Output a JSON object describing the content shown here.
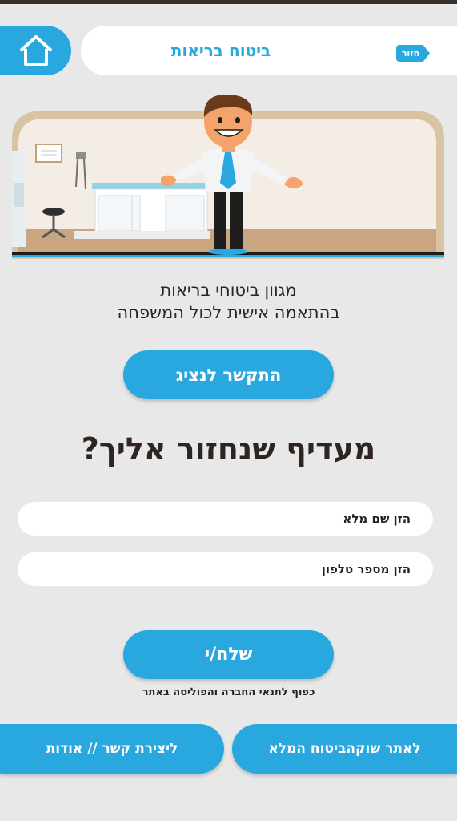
{
  "header": {
    "title": "ביטוח בריאות",
    "back_label": "חזור",
    "home_icon": "home-icon"
  },
  "hero": {
    "icon": "doctor-clinic-illustration"
  },
  "tagline": {
    "line1": "מגוון ביטוחי בריאות",
    "line2": "בהתאמה אישית לכול המשפחה"
  },
  "contact_rep_label": "התקשר לנציג",
  "callback_heading": "מעדיף שנחזור אליך?",
  "form": {
    "name_placeholder": "הזן שם מלא",
    "phone_placeholder": "הזן מספר טלפון",
    "send_label": "שלח/י",
    "terms": "כפוף לתנאי החברה והפוליסה באתר"
  },
  "footer": {
    "contact_about_label": "ליצירת קשר // אודות",
    "full_site_label": "לאתר שוקהביטוח המלא"
  },
  "colors": {
    "accent": "#29a8df",
    "background": "#e8e8e8",
    "text_dark": "#2f2520"
  }
}
